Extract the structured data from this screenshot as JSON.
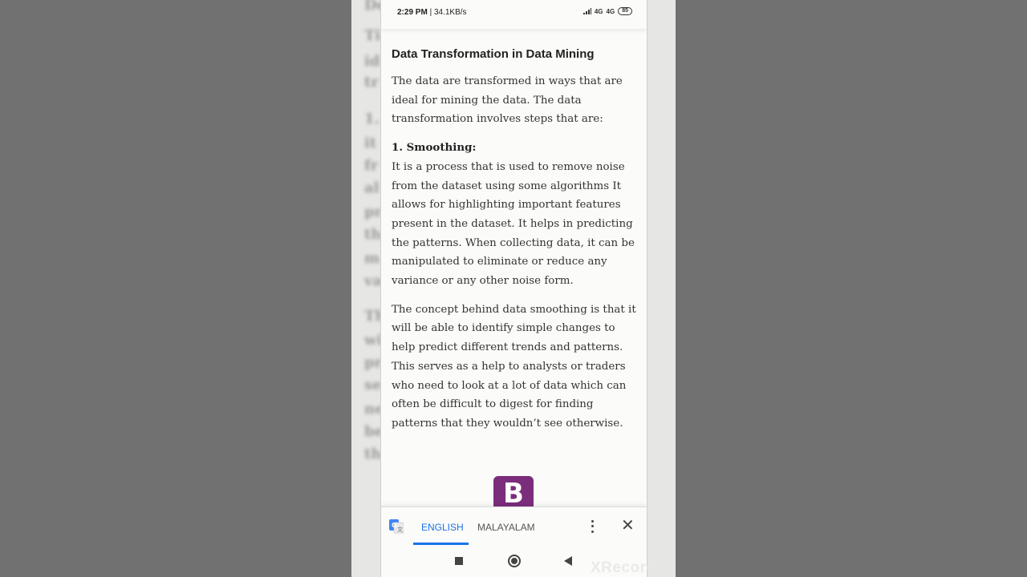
{
  "status_bar": {
    "time": "2:29 PM",
    "speed": "| 34.1KB/s",
    "network": "4G",
    "network2": "4G",
    "battery": "85"
  },
  "article": {
    "title": "Data Transformation in Data Mining",
    "intro": "The data are transformed in ways that are ideal for mining the data. The data transformation involves steps that are:",
    "step_heading": "1. Smoothing:",
    "step_body": "It is a process that is used to remove noise from the dataset using some algorithms It allows for highlighting important features present in the dataset. It helps in predicting the patterns. When collecting data, it can be manipulated to eliminate or reduce any variance or any other noise form.",
    "paragraph2": "The concept behind data smoothing is that it will be able to identify simple changes to help predict different trends and patterns. This serves as a help to analysts or traders who need to look at a lot of data which can often be difficult to digest for finding patterns that they wouldn’t see otherwise."
  },
  "app_logo": {
    "letter": "B",
    "color": "#7b2d7c"
  },
  "translate_bar": {
    "tabs": [
      "ENGLISH",
      "MALAYALAM"
    ],
    "active_tab": "ENGLISH",
    "accent": "#1a73e8"
  },
  "watermark": "XRecorder"
}
